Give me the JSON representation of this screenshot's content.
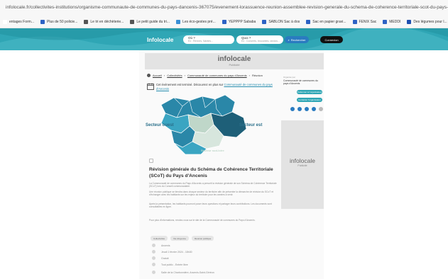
{
  "browser": {
    "url": "infolocale.fr/collectivites-institutions/organisme-communaute-de-communes-du-pays-dancenis-367075/evenement-lorassuence-reunion-assemblee-revision-generale-du-schema-de-coherence-territoriale-scot-du-pays-dancenis-7535329"
  },
  "bookmarks": [
    {
      "label": "entages Form...",
      "icon_color": "#ffffff"
    },
    {
      "label": "Plus de 50 policie...",
      "icon_color": "#2d62c4"
    },
    {
      "label": "Le tri en déchèterie...",
      "icon_color": "#555555"
    },
    {
      "label": "Le petit guide du tri...",
      "icon_color": "#555555"
    },
    {
      "label": "Les éco-gestes pré...",
      "icon_color": "#3a8fd6"
    },
    {
      "label": "YEPPPP Sababa",
      "icon_color": "#2d62c4"
    },
    {
      "label": "SABLON Sac à dos",
      "icon_color": "#2d62c4"
    },
    {
      "label": "Sac en papier gravi...",
      "icon_color": "#2d62c4"
    },
    {
      "label": "FENIX Sac",
      "icon_color": "#2d62c4"
    },
    {
      "label": "MEDDI",
      "icon_color": "#2d62c4"
    },
    {
      "label": "Des légumes pour l...",
      "icon_color": "#1e4fb0"
    }
  ],
  "header": {
    "logo": "Infolocale",
    "where_label": "Où ?",
    "where_value": "Ex : Rennes, Nantes...",
    "what_label": "Quoi ?",
    "what_value": "Ex : Concerts, brocantes, randos...",
    "search_label": "Rechercher",
    "connect_label": "Connexion"
  },
  "ad_banner": {
    "brand": "infolocale",
    "sub": "Publicité"
  },
  "breadcrumb": {
    "home": "Accueil",
    "category": "Collectivités",
    "org": "Communauté de communes du pays d'Ancenis",
    "current": "Réunion"
  },
  "notice": {
    "text": "Cet événement est terminé. Découvrez en plus sur ",
    "link": "Communauté de communes du pays d'Ancenis"
  },
  "map": {
    "label_west": "Secteur ouest",
    "label_east": "Secteur est",
    "label_south": "Secteur sud-loire"
  },
  "article": {
    "title": "Révision générale du Schéma de Cohérence Territoriale (SCoT) du Pays d'Ancenis",
    "paragraphs": [
      "La Communauté de communes du Pays d'Ancenis a prescrit la révision générale de son Schéma de Cohérence Territoriale (SCoT) lors du Conseil communautaire.",
      "Une réunion publique se tiendra dans chaque secteur du territoire afin de présenter la démarche de révision du SCoT et d'échanger avec les habitants sur les enjeux du territoire pour les années à venir.",
      "Après la présentation, les habitants pourront poser leurs questions et partager leurs contributions. Les documents sont consultables en ligne.",
      "Pour plus d'informations, rendez-vous sur le site de la Communauté de communes du Pays d'Ancenis."
    ]
  },
  "tags": [
    "Collectivités",
    "Vie citoyenne",
    "Réunion publique"
  ],
  "info_rows": [
    "Ancenis",
    "Jeudi 1 février 2024 - 18h30",
    "Gratuit",
    "Tout public - Entrée libre",
    "Salle de la Charbonnière, Ancenis-Saint-Géréon"
  ],
  "sidebar": {
    "org_prefix": "Organisé par",
    "org_name": "Communauté de communes du pays d'Ancenis",
    "follow_button": "S'abonner à l'organisateur",
    "contact_button": "Contacter l'organisateur"
  },
  "side_ad": {
    "brand": "infolocale",
    "sub": "Publicité"
  },
  "colors": {
    "hero": "#2fa6b5",
    "accent": "#2a7bc0",
    "map_dark": "#1e5f78",
    "map_mid": "#2a87a8",
    "map_light": "#bfd7c9"
  }
}
